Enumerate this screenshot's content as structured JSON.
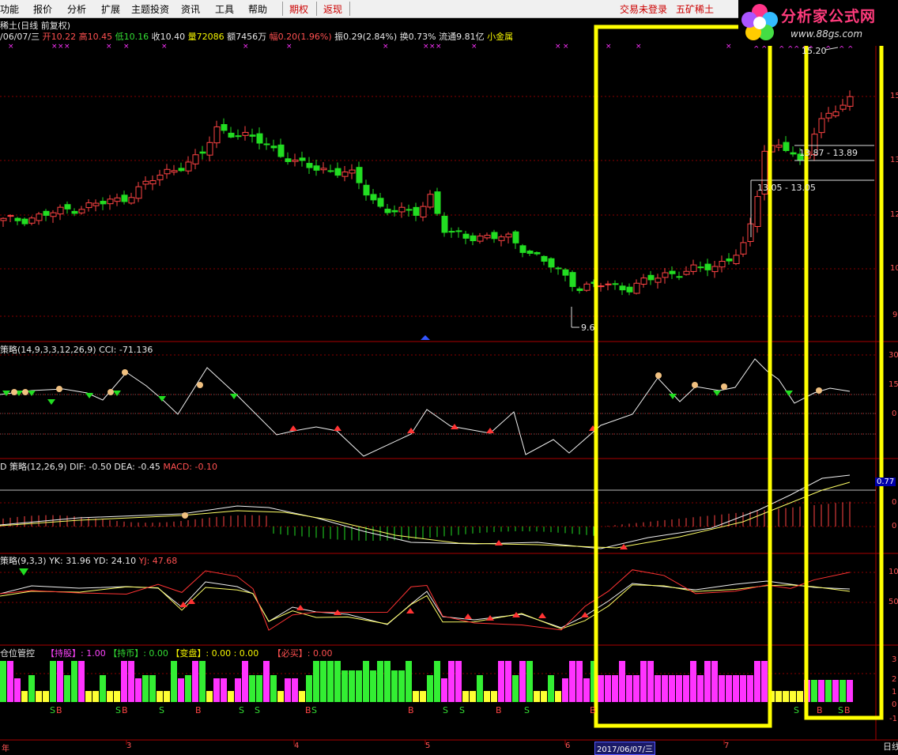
{
  "menu": {
    "items": [
      "功能",
      "报价",
      "分析",
      "扩展",
      "主题投资",
      "资讯",
      "工具",
      "帮助"
    ],
    "right_items": [
      "期权",
      "返现"
    ],
    "status": "交易未登录",
    "stock_name_top": "五矿稀土"
  },
  "logo": {
    "name": "分析家公式网",
    "url": "www.88gs.com"
  },
  "header": {
    "title": "稀土(日线 前复权)",
    "date": "/06/07/三",
    "open_label": "开",
    "open": "10.22",
    "high_label": "高",
    "high": "10.45",
    "low_label": "低",
    "low": "10.16",
    "close_label": "收",
    "close": "10.40",
    "volume_label": "量",
    "volume": "72086",
    "amount_label": "额",
    "amount": "7456万",
    "change_label": "幅",
    "change": "0.20(1.96%)",
    "amplitude": "振0.29(2.84%)",
    "turnover": "换0.73%",
    "float_cap": "流通9.81亿",
    "sector": "小金属"
  },
  "price_panel": {
    "axis_labels": [
      "15",
      "13",
      "12",
      "10",
      "9"
    ],
    "low_marker": "9.6",
    "high_marker": "15.20",
    "range_box_1": "13.87 - 13.89",
    "range_box_2": "13.05 - 13.05"
  },
  "cci_panel": {
    "title": "策略(14,9,3,3,12,26,9)",
    "cci_label": "CCI: -71.136",
    "axis_labels": [
      "30",
      "15",
      "0"
    ]
  },
  "macd_panel": {
    "title": "D 策略(12,26,9)",
    "dif": "DIF: -0.50",
    "dea": "DEA: -0.45",
    "macd": "MACD: -0.10",
    "axis_labels": [
      "0.77",
      "0",
      "0"
    ]
  },
  "kdj_panel": {
    "title": "策略(9,3,3)",
    "yk": "YK: 31.96",
    "yd": "YD: 24.10",
    "yj": "YJ: 47.68",
    "axis_labels": [
      "10",
      "50"
    ]
  },
  "position_panel": {
    "title": "仓位管控",
    "hold_stock": "【持股】: 1.00",
    "hold_cash": "【持币】: 0.00",
    "change": "【变盘】: 0.00 : 0.00",
    "must_buy": "【必买】: 0.00",
    "axis_labels": [
      "3",
      "2",
      "1",
      "0",
      "-1"
    ],
    "signals": [
      {
        "text": "S",
        "color": "#33dd33"
      },
      {
        "text": "B",
        "color": "#ff4444"
      },
      {
        "text": "S",
        "color": "#33dd33"
      },
      {
        "text": "B",
        "color": "#ff4444"
      },
      {
        "text": "S",
        "color": "#33dd33"
      },
      {
        "text": "B",
        "color": "#ff4444"
      },
      {
        "text": "S",
        "color": "#33dd33"
      },
      {
        "text": "S",
        "color": "#33dd33"
      },
      {
        "text": "B",
        "color": "#ff4444"
      },
      {
        "text": "S",
        "color": "#33dd33"
      },
      {
        "text": "B",
        "color": "#ff4444"
      },
      {
        "text": "S",
        "color": "#33dd33"
      },
      {
        "text": "S",
        "color": "#33dd33"
      },
      {
        "text": "B",
        "color": "#ff4444"
      },
      {
        "text": "S",
        "color": "#33dd33"
      },
      {
        "text": "B",
        "color": "#ff4444"
      },
      {
        "text": "S",
        "color": "#33dd33"
      },
      {
        "text": "B",
        "color": "#ff4444"
      },
      {
        "text": "S",
        "color": "#33dd33"
      },
      {
        "text": "B",
        "color": "#ff4444"
      }
    ]
  },
  "date_axis": {
    "labels": [
      "年",
      "3",
      "4",
      "5",
      "6",
      "7"
    ],
    "cursor_date": "2017/06/07/三",
    "period_label": "日线"
  },
  "colors": {
    "up": "#ff4444",
    "down": "#22dd22",
    "highlight": "#ffff00",
    "magenta": "#ff33ff",
    "grid": "#880000"
  }
}
